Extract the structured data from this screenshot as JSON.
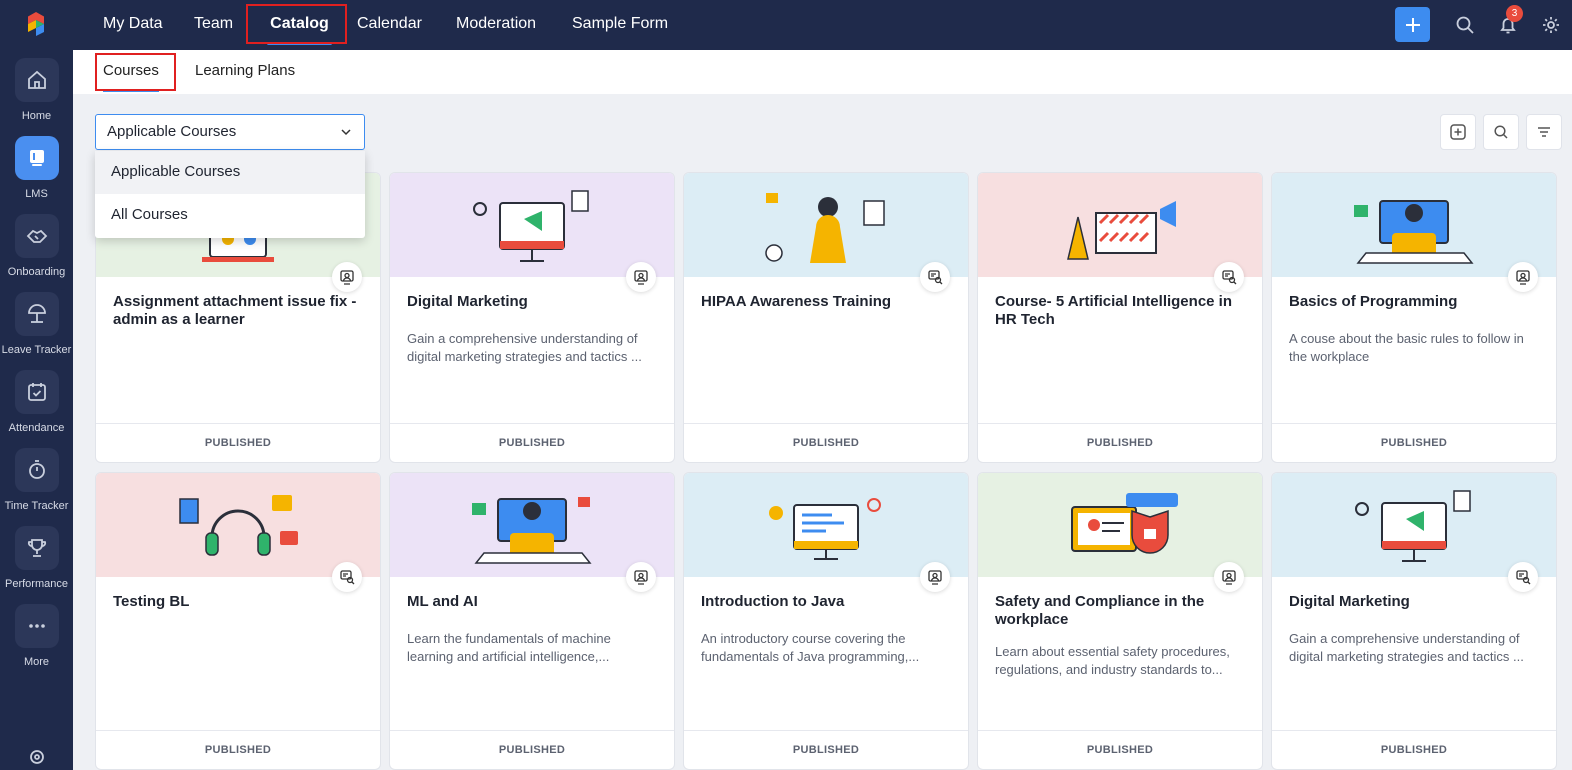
{
  "sidebar": {
    "items": [
      {
        "label": "Home",
        "icon": "home-icon"
      },
      {
        "label": "LMS",
        "icon": "lms-icon"
      },
      {
        "label": "Onboarding",
        "icon": "handshake-icon"
      },
      {
        "label": "Leave Tracker",
        "icon": "beach-umbrella-icon"
      },
      {
        "label": "Attendance",
        "icon": "calendar-check-icon"
      },
      {
        "label": "Time Tracker",
        "icon": "stopwatch-icon"
      },
      {
        "label": "Performance",
        "icon": "trophy-icon"
      },
      {
        "label": "More",
        "icon": "more-dots-icon"
      }
    ]
  },
  "topnav": {
    "tabs": [
      "My Data",
      "Team",
      "Catalog",
      "Calendar",
      "Moderation",
      "Sample Form"
    ],
    "active": "Catalog",
    "notification_count": "3"
  },
  "subnav": {
    "tabs": [
      "Courses",
      "Learning Plans"
    ],
    "active": "Courses"
  },
  "filter": {
    "selected": "Applicable Courses",
    "options": [
      "Applicable Courses",
      "All Courses"
    ]
  },
  "courses": [
    {
      "title": "Assignment attachment issue fix - admin as a learner",
      "desc": "",
      "status": "PUBLISHED",
      "bg": "#e6f1e3"
    },
    {
      "title": "Digital Marketing",
      "desc": "Gain a comprehensive understanding of digital marketing strategies and tactics ...",
      "status": "PUBLISHED",
      "bg": "#ece3f7"
    },
    {
      "title": "HIPAA Awareness Training",
      "desc": "",
      "status": "PUBLISHED",
      "bg": "#dcedf5"
    },
    {
      "title": "Course- 5 Artificial Intelligence in HR Tech",
      "desc": "",
      "status": "PUBLISHED",
      "bg": "#f7dfe0"
    },
    {
      "title": "Basics of Programming",
      "desc": "A couse about the basic rules to follow in the workplace",
      "status": "PUBLISHED",
      "bg": "#dcedf5"
    },
    {
      "title": "Testing BL",
      "desc": "",
      "status": "PUBLISHED",
      "bg": "#f7dfe0"
    },
    {
      "title": "ML and AI",
      "desc": "Learn the fundamentals of machine learning and artificial intelligence,...",
      "status": "PUBLISHED",
      "bg": "#ece3f7"
    },
    {
      "title": "Introduction to Java",
      "desc": "An introductory course covering the fundamentals of Java programming,...",
      "status": "PUBLISHED",
      "bg": "#dcedf5"
    },
    {
      "title": "Safety and Compliance in the workplace",
      "desc": "Learn about essential safety procedures, regulations, and industry standards to...",
      "status": "PUBLISHED",
      "bg": "#e6f1e3"
    },
    {
      "title": "Digital Marketing",
      "desc": "Gain a comprehensive understanding of digital marketing strategies and tactics ...",
      "status": "PUBLISHED",
      "bg": "#dcedf5"
    }
  ],
  "colors": {
    "accent": "#3d8cf0",
    "nav_bg": "#1f2a4b",
    "highlight_box": "#e02020",
    "badge": "#e94c3d"
  }
}
